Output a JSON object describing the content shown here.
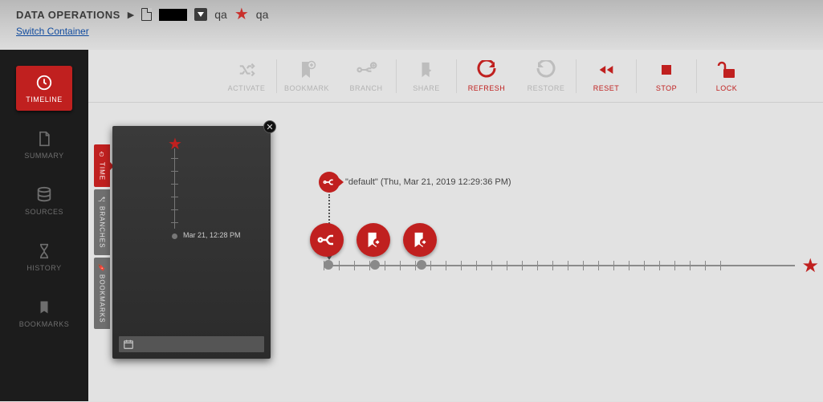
{
  "header": {
    "title": "DATA OPERATIONS",
    "items": [
      {
        "label": "qa",
        "icon": "download-box"
      },
      {
        "label": "qa",
        "icon": "star"
      }
    ],
    "switch_link": "Switch Container"
  },
  "sidebar": {
    "items": [
      {
        "id": "timeline",
        "label": "TIMELINE",
        "icon": "clock",
        "active": true
      },
      {
        "id": "summary",
        "label": "SUMMARY",
        "icon": "document",
        "active": false
      },
      {
        "id": "sources",
        "label": "SOURCES",
        "icon": "database",
        "active": false
      },
      {
        "id": "history",
        "label": "HISTORY",
        "icon": "hourglass",
        "active": false
      },
      {
        "id": "bookmarks",
        "label": "BOOKMARKS",
        "icon": "bookmark",
        "active": false
      }
    ]
  },
  "toolbar": {
    "items": [
      {
        "id": "activate",
        "label": "ACTIVATE",
        "icon": "shuffle",
        "enabled": false
      },
      {
        "id": "bookmark",
        "label": "BOOKMARK",
        "icon": "bookmark-add",
        "enabled": false
      },
      {
        "id": "branch",
        "label": "BRANCH",
        "icon": "branch-add",
        "enabled": false
      },
      {
        "id": "share",
        "label": "SHARE",
        "icon": "share",
        "enabled": false
      },
      {
        "id": "refresh",
        "label": "REFRESH",
        "icon": "refresh",
        "enabled": true
      },
      {
        "id": "restore",
        "label": "RESTORE",
        "icon": "restore",
        "enabled": false
      },
      {
        "id": "reset",
        "label": "RESET",
        "icon": "rewind",
        "enabled": true
      },
      {
        "id": "stop",
        "label": "STOP",
        "icon": "stop",
        "enabled": true
      },
      {
        "id": "lock",
        "label": "LOCK",
        "icon": "lock-open",
        "enabled": true
      }
    ],
    "separators_after": [
      "activate",
      "branch",
      "share",
      "restore",
      "reset",
      "stop"
    ]
  },
  "vertical_tabs": [
    {
      "id": "time",
      "label": "TIME",
      "active": true
    },
    {
      "id": "branches",
      "label": "BRANCHES",
      "active": false
    },
    {
      "id": "bookmarks",
      "label": "BOOKMARKS",
      "active": false
    }
  ],
  "timeline_panel": {
    "point_label": "Mar 21, 12:28 PM"
  },
  "callout": {
    "text": "\"default\" (Thu, Mar 21, 2019 12:29:36 PM)"
  },
  "action_circles": [
    {
      "id": "branch-node",
      "icon": "branch"
    },
    {
      "id": "bookmark-1",
      "icon": "bookmark-export"
    },
    {
      "id": "bookmark-2",
      "icon": "bookmark-export"
    }
  ],
  "colors": {
    "accent": "#c0201f"
  }
}
